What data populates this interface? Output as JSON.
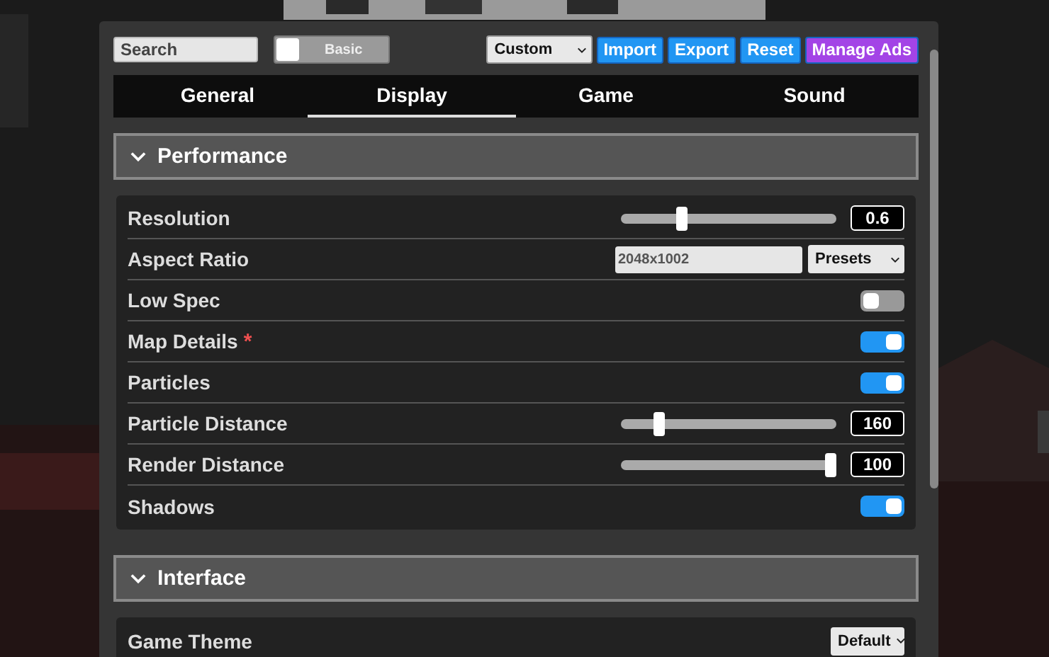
{
  "toolbar": {
    "search": {
      "placeholder": "Search"
    },
    "basic_mode": {
      "label": "Basic",
      "on": false
    },
    "preset_select": {
      "value": "Custom"
    },
    "buttons": [
      {
        "label": "Import",
        "color": "#2196f3"
      },
      {
        "label": "Export",
        "color": "#2196f3"
      },
      {
        "label": "Reset",
        "color": "#2196f3"
      },
      {
        "label": "Manage Ads",
        "color": "#a344e6"
      }
    ]
  },
  "tabs": [
    {
      "label": "General",
      "selected": false
    },
    {
      "label": "Display",
      "selected": true
    },
    {
      "label": "Game",
      "selected": false
    },
    {
      "label": "Sound",
      "selected": false
    }
  ],
  "sections": [
    {
      "title": "Performance",
      "expanded": true,
      "settings": [
        {
          "kind": "slider",
          "label": "Resolution",
          "level": 0.27,
          "value": "0.6"
        },
        {
          "kind": "text",
          "label": "Aspect Ratio",
          "value": "2048x1002",
          "select": "Presets"
        },
        {
          "kind": "toggle",
          "label": "Low Spec",
          "on": false
        },
        {
          "kind": "toggle",
          "label": "Map Details",
          "marker": "*",
          "on": true
        },
        {
          "kind": "toggle",
          "label": "Particles",
          "on": true
        },
        {
          "kind": "slider",
          "label": "Particle Distance",
          "level": 0.16,
          "value": "160"
        },
        {
          "kind": "slider",
          "label": "Render Distance",
          "level": 1.0,
          "value": "100"
        },
        {
          "kind": "toggle",
          "label": "Shadows",
          "on": true
        }
      ]
    },
    {
      "title": "Interface",
      "expanded": true,
      "settings": [
        {
          "kind": "select",
          "label": "Game Theme",
          "select": "Default"
        }
      ]
    }
  ]
}
